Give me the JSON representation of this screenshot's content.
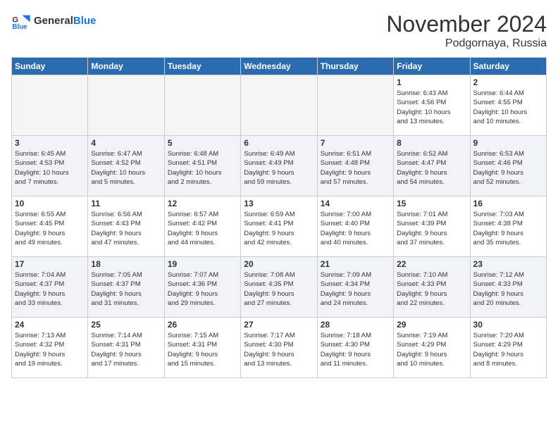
{
  "logo": {
    "text_general": "General",
    "text_blue": "Blue"
  },
  "header": {
    "title": "November 2024",
    "subtitle": "Podgornaya, Russia"
  },
  "weekdays": [
    "Sunday",
    "Monday",
    "Tuesday",
    "Wednesday",
    "Thursday",
    "Friday",
    "Saturday"
  ],
  "weeks": [
    [
      {
        "day": "",
        "info": ""
      },
      {
        "day": "",
        "info": ""
      },
      {
        "day": "",
        "info": ""
      },
      {
        "day": "",
        "info": ""
      },
      {
        "day": "",
        "info": ""
      },
      {
        "day": "1",
        "info": "Sunrise: 6:43 AM\nSunset: 4:56 PM\nDaylight: 10 hours\nand 13 minutes."
      },
      {
        "day": "2",
        "info": "Sunrise: 6:44 AM\nSunset: 4:55 PM\nDaylight: 10 hours\nand 10 minutes."
      }
    ],
    [
      {
        "day": "3",
        "info": "Sunrise: 6:45 AM\nSunset: 4:53 PM\nDaylight: 10 hours\nand 7 minutes."
      },
      {
        "day": "4",
        "info": "Sunrise: 6:47 AM\nSunset: 4:52 PM\nDaylight: 10 hours\nand 5 minutes."
      },
      {
        "day": "5",
        "info": "Sunrise: 6:48 AM\nSunset: 4:51 PM\nDaylight: 10 hours\nand 2 minutes."
      },
      {
        "day": "6",
        "info": "Sunrise: 6:49 AM\nSunset: 4:49 PM\nDaylight: 9 hours\nand 59 minutes."
      },
      {
        "day": "7",
        "info": "Sunrise: 6:51 AM\nSunset: 4:48 PM\nDaylight: 9 hours\nand 57 minutes."
      },
      {
        "day": "8",
        "info": "Sunrise: 6:52 AM\nSunset: 4:47 PM\nDaylight: 9 hours\nand 54 minutes."
      },
      {
        "day": "9",
        "info": "Sunrise: 6:53 AM\nSunset: 4:46 PM\nDaylight: 9 hours\nand 52 minutes."
      }
    ],
    [
      {
        "day": "10",
        "info": "Sunrise: 6:55 AM\nSunset: 4:45 PM\nDaylight: 9 hours\nand 49 minutes."
      },
      {
        "day": "11",
        "info": "Sunrise: 6:56 AM\nSunset: 4:43 PM\nDaylight: 9 hours\nand 47 minutes."
      },
      {
        "day": "12",
        "info": "Sunrise: 6:57 AM\nSunset: 4:42 PM\nDaylight: 9 hours\nand 44 minutes."
      },
      {
        "day": "13",
        "info": "Sunrise: 6:59 AM\nSunset: 4:41 PM\nDaylight: 9 hours\nand 42 minutes."
      },
      {
        "day": "14",
        "info": "Sunrise: 7:00 AM\nSunset: 4:40 PM\nDaylight: 9 hours\nand 40 minutes."
      },
      {
        "day": "15",
        "info": "Sunrise: 7:01 AM\nSunset: 4:39 PM\nDaylight: 9 hours\nand 37 minutes."
      },
      {
        "day": "16",
        "info": "Sunrise: 7:03 AM\nSunset: 4:38 PM\nDaylight: 9 hours\nand 35 minutes."
      }
    ],
    [
      {
        "day": "17",
        "info": "Sunrise: 7:04 AM\nSunset: 4:37 PM\nDaylight: 9 hours\nand 33 minutes."
      },
      {
        "day": "18",
        "info": "Sunrise: 7:05 AM\nSunset: 4:37 PM\nDaylight: 9 hours\nand 31 minutes."
      },
      {
        "day": "19",
        "info": "Sunrise: 7:07 AM\nSunset: 4:36 PM\nDaylight: 9 hours\nand 29 minutes."
      },
      {
        "day": "20",
        "info": "Sunrise: 7:08 AM\nSunset: 4:35 PM\nDaylight: 9 hours\nand 27 minutes."
      },
      {
        "day": "21",
        "info": "Sunrise: 7:09 AM\nSunset: 4:34 PM\nDaylight: 9 hours\nand 24 minutes."
      },
      {
        "day": "22",
        "info": "Sunrise: 7:10 AM\nSunset: 4:33 PM\nDaylight: 9 hours\nand 22 minutes."
      },
      {
        "day": "23",
        "info": "Sunrise: 7:12 AM\nSunset: 4:33 PM\nDaylight: 9 hours\nand 20 minutes."
      }
    ],
    [
      {
        "day": "24",
        "info": "Sunrise: 7:13 AM\nSunset: 4:32 PM\nDaylight: 9 hours\nand 19 minutes."
      },
      {
        "day": "25",
        "info": "Sunrise: 7:14 AM\nSunset: 4:31 PM\nDaylight: 9 hours\nand 17 minutes."
      },
      {
        "day": "26",
        "info": "Sunrise: 7:15 AM\nSunset: 4:31 PM\nDaylight: 9 hours\nand 15 minutes."
      },
      {
        "day": "27",
        "info": "Sunrise: 7:17 AM\nSunset: 4:30 PM\nDaylight: 9 hours\nand 13 minutes."
      },
      {
        "day": "28",
        "info": "Sunrise: 7:18 AM\nSunset: 4:30 PM\nDaylight: 9 hours\nand 11 minutes."
      },
      {
        "day": "29",
        "info": "Sunrise: 7:19 AM\nSunset: 4:29 PM\nDaylight: 9 hours\nand 10 minutes."
      },
      {
        "day": "30",
        "info": "Sunrise: 7:20 AM\nSunset: 4:29 PM\nDaylight: 9 hours\nand 8 minutes."
      }
    ]
  ]
}
